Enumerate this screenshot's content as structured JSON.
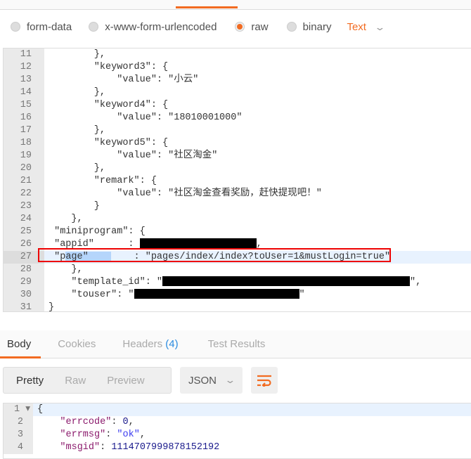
{
  "body_options": {
    "items": [
      "form-data",
      "x-www-form-urlencoded",
      "raw",
      "binary"
    ],
    "selected": "raw",
    "format": "Text"
  },
  "request_lines": [
    {
      "n": "11",
      "parts": [
        "        },"
      ]
    },
    {
      "n": "12",
      "parts": [
        "        \"keyword3\": {"
      ]
    },
    {
      "n": "13",
      "parts": [
        "            \"value\": \"小云\""
      ]
    },
    {
      "n": "14",
      "parts": [
        "        },"
      ]
    },
    {
      "n": "15",
      "parts": [
        "        \"keyword4\": {"
      ]
    },
    {
      "n": "16",
      "parts": [
        "            \"value\": \"18010001000\""
      ]
    },
    {
      "n": "17",
      "parts": [
        "        },"
      ]
    },
    {
      "n": "18",
      "parts": [
        "        \"keyword5\": {"
      ]
    },
    {
      "n": "19",
      "parts": [
        "            \"value\": \"社区淘金\""
      ]
    },
    {
      "n": "20",
      "parts": [
        "        },"
      ]
    },
    {
      "n": "21",
      "parts": [
        "        \"remark\": {"
      ]
    },
    {
      "n": "22",
      "parts": [
        "            \"value\": \"社区淘金查看奖励，赶快提现吧！\""
      ]
    },
    {
      "n": "23",
      "parts": [
        "        }"
      ]
    },
    {
      "n": "24",
      "parts": [
        "    },"
      ]
    },
    {
      "n": "25",
      "parts": [
        " \"miniprogram\": {"
      ]
    },
    {
      "n": "26",
      "parts": [
        " \"appid\"      : ",
        {
          "redacted": "r1"
        },
        ","
      ]
    },
    {
      "n": "27",
      "parts": [
        " \"p",
        {
          "sel": "age\"    "
        },
        "    : \"pages/index/index?toUser=1&mustLogin=true\""
      ],
      "active": true
    },
    {
      "n": "28",
      "parts": [
        "    },"
      ]
    },
    {
      "n": "29",
      "parts": [
        "    \"template_id\": \"",
        {
          "redacted": "r2"
        },
        "\","
      ]
    },
    {
      "n": "30",
      "parts": [
        "    \"touser\": \"",
        {
          "redacted": "r3"
        },
        "\""
      ]
    },
    {
      "n": "31",
      "parts": [
        "}"
      ]
    }
  ],
  "response_tabs": [
    {
      "label": "Body"
    },
    {
      "label": "Cookies"
    },
    {
      "label": "Headers",
      "count": "(4)"
    },
    {
      "label": "Test Results"
    }
  ],
  "view_modes": [
    "Pretty",
    "Raw",
    "Preview"
  ],
  "response_format": "JSON",
  "response_lines": [
    {
      "n": "1",
      "parts": [
        [
          "p",
          "{"
        ]
      ]
    },
    {
      "n": "2",
      "parts": [
        [
          "p",
          "    "
        ],
        [
          "k",
          "\"errcode\""
        ],
        [
          "p",
          ": "
        ],
        [
          "n",
          "0"
        ],
        [
          "p",
          ","
        ]
      ]
    },
    {
      "n": "3",
      "parts": [
        [
          "p",
          "    "
        ],
        [
          "k",
          "\"errmsg\""
        ],
        [
          "p",
          ": "
        ],
        [
          "s",
          "\"ok\""
        ],
        [
          "p",
          ","
        ]
      ]
    },
    {
      "n": "4",
      "parts": [
        [
          "p",
          "    "
        ],
        [
          "k",
          "\"msgid\""
        ],
        [
          "p",
          ": "
        ],
        [
          "n",
          "1114707999878152192"
        ]
      ]
    }
  ]
}
